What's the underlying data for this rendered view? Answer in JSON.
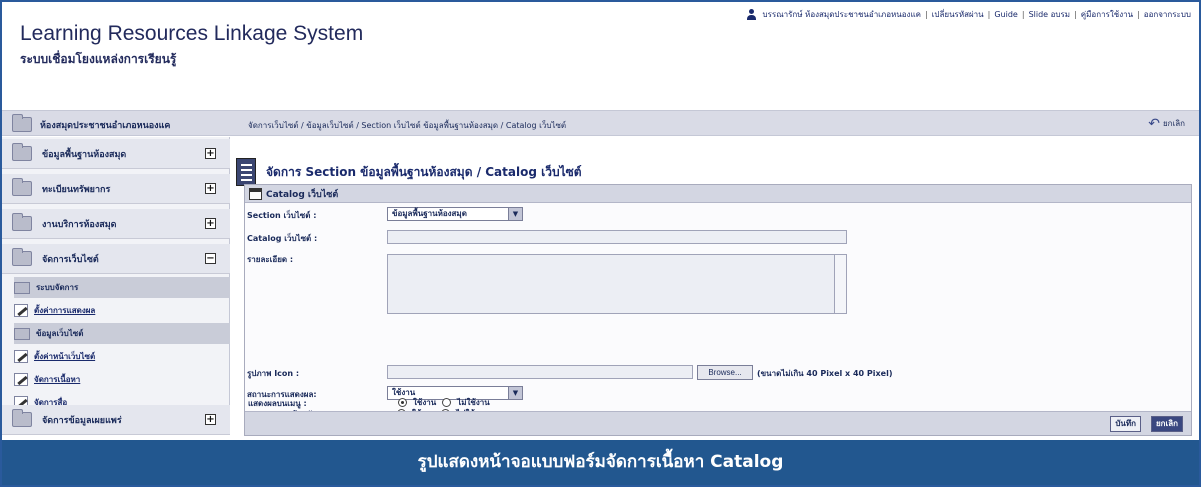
{
  "header": {
    "title": "Learning Resources Linkage System",
    "subtitle": "ระบบเชื่อมโยงแหล่งการเรียนรู้",
    "top_links": [
      "บรรณารักษ์ ห้องสมุดประชาชนอำเภอหนองแค",
      "เปลี่ยนรหัสผ่าน",
      "Guide",
      "Slide อบรม",
      "คู่มือการใช้งาน",
      "ออกจากระบบ"
    ]
  },
  "topbar": {
    "library_name": "ห้องสมุดประชาชนอำเภอหนองแค",
    "breadcrumb": "จัดการเว็บไซต์ / ข้อมูลเว็บไซต์ / Section เว็บไซต์ ข้อมูลพื้นฐานห้องสมุด / Catalog เว็บไซต์",
    "back_label": "ยกเลิก"
  },
  "sidebar": {
    "items": [
      {
        "label": "ข้อมูลพื้นฐานห้องสมุด",
        "toggle": "+"
      },
      {
        "label": "ทะเบียนทรัพยากร",
        "toggle": "+"
      },
      {
        "label": "งานบริการห้องสมุด",
        "toggle": "+"
      },
      {
        "label": "จัดการเว็บไซต์",
        "toggle": "−"
      },
      {
        "label": "จัดการข้อมูลเผยแพร่",
        "toggle": "+"
      }
    ],
    "sub_items": [
      {
        "label": "ระบบจัดการ"
      },
      {
        "label": "ตั้งค่าการแสดงผล"
      },
      {
        "label": "ข้อมูลเว็บไซต์"
      },
      {
        "label": "ตั้งค่าหน้าเว็บไซต์"
      },
      {
        "label": "จัดการเนื้อหา"
      },
      {
        "label": "จัดการสื่อ"
      }
    ]
  },
  "main": {
    "page_title": "จัดการ Section ข้อมูลพื้นฐานห้องสมุด / Catalog เว็บไซต์",
    "form_title": "Catalog เว็บไซต์",
    "fields": {
      "section_label": "Section เว็บไซต์ :",
      "section_value": "ข้อมูลพื้นฐานห้องสมุด",
      "catalog_label": "Catalog เว็บไซต์ :",
      "catalog_value": "",
      "detail_label": "รายละเอียด :",
      "icon_label": "รูปภาพ Icon :",
      "browse_label": "Browse...",
      "icon_hint": "(ขนาดไม่เกิน 40 Pixel x 40 Pixel)",
      "status_label": "สถานะการแสดงผล:",
      "status_value": "ใช้งาน",
      "home_label": "แสดงผลบนหน้าหลัก :",
      "menu_label": "แสดงผลบนเมนู :",
      "radio_on": "ใช้งาน",
      "radio_off": "ไม่ใช้งาน"
    },
    "save_label": "บันทึก",
    "cancel_label": "ยกเลิก"
  },
  "caption": "รูปแสดงหน้าจอแบบฟอร์มจัดการเนื้อหา Catalog"
}
